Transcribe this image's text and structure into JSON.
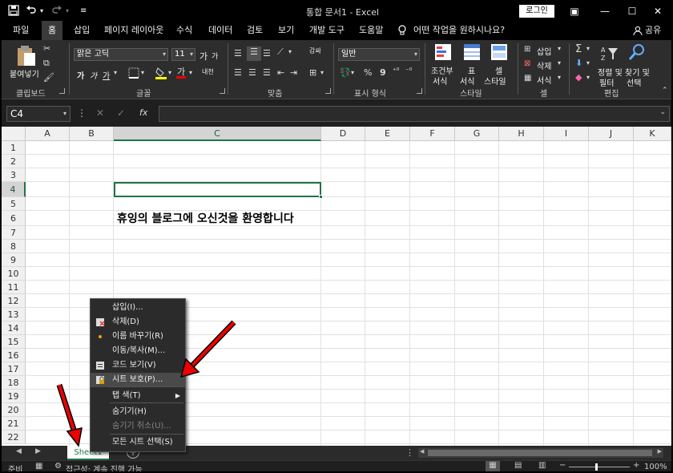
{
  "window": {
    "title": "통합 문서1  -  Excel",
    "login_label": "로그인",
    "quick_access": {
      "save_icon": "save-icon",
      "undo_icon": "undo-icon",
      "redo_icon": "redo-icon"
    },
    "controls": {
      "ribbon_display": "▣",
      "minimize": "—",
      "maximize": "☐",
      "close": "✕"
    }
  },
  "tabs": [
    "파일",
    "홈",
    "삽입",
    "페이지 레이아웃",
    "수식",
    "데이터",
    "검토",
    "보기",
    "개발 도구",
    "도움말"
  ],
  "tell_me": "어떤 작업을 원하시나요?",
  "share_label": "공유",
  "ribbon": {
    "clipboard": {
      "paste": "붙여넣기",
      "label": "클립보드"
    },
    "font": {
      "name": "맑은 고딕",
      "size": "11",
      "grow": "가",
      "shrink": "가",
      "bold": "가",
      "italic": "가",
      "underline": "가",
      "label": "글꼴",
      "phonetic": "내천"
    },
    "alignment": {
      "label": "맞춤",
      "wrap": "감싸"
    },
    "number": {
      "format": "일반",
      "label": "표시 형식"
    },
    "styles": {
      "conditional": "조건부",
      "conditional2": "서식",
      "table": "표",
      "table2": "서식",
      "cell": "셀",
      "cell2": "스타일",
      "label": "스타일"
    },
    "cells": {
      "insert": "삽입",
      "delete": "삭제",
      "format": "서식",
      "label": "셀"
    },
    "editing": {
      "sort": "정렬 및",
      "sort2": "필터",
      "find": "찾기 및",
      "find2": "선택",
      "label": "편집"
    }
  },
  "formula_bar": {
    "name_box": "C4",
    "fx": "fx",
    "cancel": "✕",
    "enter": "✓",
    "value": ""
  },
  "grid": {
    "columns": [
      "A",
      "B",
      "C",
      "D",
      "E",
      "F",
      "G",
      "H",
      "I",
      "J",
      "K"
    ],
    "rows": [
      "1",
      "2",
      "3",
      "4",
      "5",
      "6",
      "7",
      "8",
      "9",
      "10",
      "11",
      "12",
      "13",
      "14",
      "15",
      "16",
      "17",
      "18",
      "19",
      "20",
      "21",
      "22"
    ],
    "selected_cell": "C4",
    "cell_c6": "휴잉의 블로그에 오신것을 환영합니다"
  },
  "context_menu": {
    "items": [
      {
        "label": "삽입(I)...",
        "icon": ""
      },
      {
        "label": "삭제(D)",
        "icon": "delete-sheet-icon"
      },
      {
        "label": "이름 바꾸기(R)",
        "icon": "rename-icon"
      },
      {
        "label": "이동/복사(M)...",
        "icon": ""
      },
      {
        "label": "코드 보기(V)",
        "icon": "view-code-icon"
      },
      {
        "label": "시트 보호(P)...",
        "icon": "protect-sheet-icon"
      },
      {
        "label": "탭 색(T)",
        "icon": ""
      },
      {
        "label": "숨기기(H)",
        "icon": ""
      },
      {
        "label": "숨기기 취소(U)...",
        "icon": ""
      },
      {
        "label": "모든 시트 선택(S)",
        "icon": ""
      }
    ]
  },
  "sheet_tabs": {
    "active": "Sheet1",
    "add": "+"
  },
  "status": {
    "ready": "준비",
    "accessibility": "접근성: 계속 진행 가능",
    "zoom": "100%"
  }
}
